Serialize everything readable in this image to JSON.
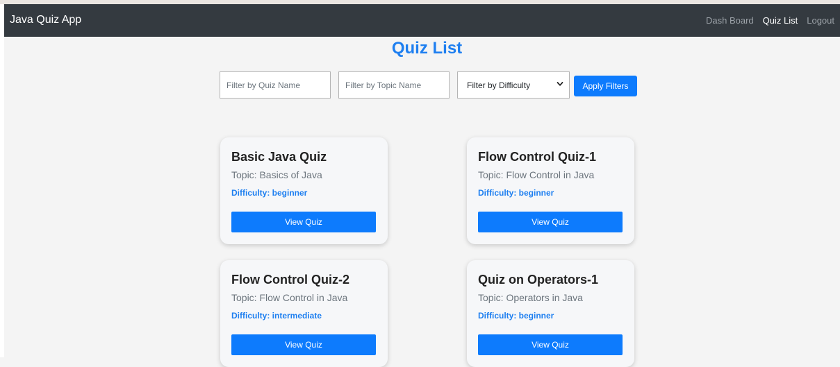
{
  "navbar": {
    "brand": "Java Quiz App",
    "links": [
      {
        "label": "Dash Board",
        "active": false
      },
      {
        "label": "Quiz List",
        "active": true
      },
      {
        "label": "Logout",
        "active": false
      }
    ]
  },
  "page": {
    "title": "Quiz List"
  },
  "filters": {
    "quiz_name_placeholder": "Filter by Quiz Name",
    "topic_name_placeholder": "Filter by Topic Name",
    "difficulty_selected": "Filter by Difficulty",
    "apply_label": "Apply Filters"
  },
  "quizzes": [
    {
      "title": "Basic Java Quiz",
      "topic": "Topic: Basics of Java",
      "difficulty": "Difficulty: beginner",
      "button": "View Quiz"
    },
    {
      "title": "Flow Control Quiz-1",
      "topic": "Topic: Flow Control in Java",
      "difficulty": "Difficulty: beginner",
      "button": "View Quiz"
    },
    {
      "title": "Flow Control Quiz-2",
      "topic": "Topic: Flow Control in Java",
      "difficulty": "Difficulty: intermediate",
      "button": "View Quiz"
    },
    {
      "title": "Quiz on Operators-1",
      "topic": "Topic: Operators in Java",
      "difficulty": "Difficulty: beginner",
      "button": "View Quiz"
    }
  ],
  "colors": {
    "navbar_bg": "#343a40",
    "accent": "#1e7ff0",
    "button_bg": "#0d7bfd",
    "page_bg": "#f4f4f4"
  },
  "icons": {
    "select_arrow": "chevron-down-icon"
  }
}
